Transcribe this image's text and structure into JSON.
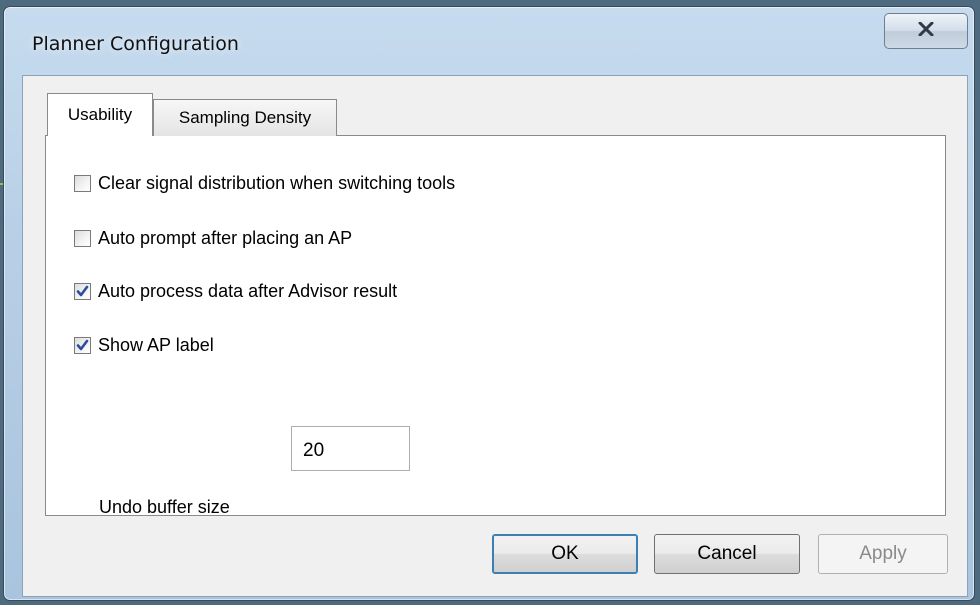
{
  "window": {
    "title": "Planner Configuration",
    "close_icon": "close-icon"
  },
  "tabs": [
    {
      "label": "Usability",
      "active": true
    },
    {
      "label": "Sampling Density",
      "active": false
    }
  ],
  "usability": {
    "checkboxes": [
      {
        "label": "Clear signal distribution when switching tools",
        "checked": false
      },
      {
        "label": "Auto prompt after placing an AP",
        "checked": false
      },
      {
        "label": "Auto process data after Advisor result",
        "checked": true
      },
      {
        "label": "Show AP label",
        "checked": true
      }
    ],
    "undo_label": "Undo buffer size",
    "undo_value": "20"
  },
  "buttons": {
    "ok": "OK",
    "cancel": "Cancel",
    "apply": "Apply"
  },
  "colors": {
    "checkmark": "#2b4f9e",
    "title_bar": "#b7cfe6",
    "disabled_text": "#8a8a8a"
  }
}
